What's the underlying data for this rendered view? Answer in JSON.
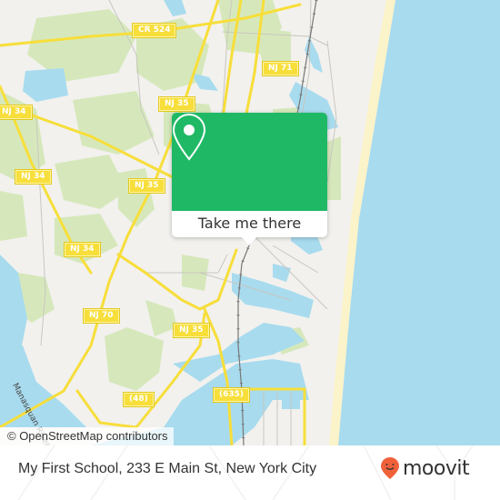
{
  "map": {
    "colors": {
      "land": "#f2f1ee",
      "water": "#a8dbee",
      "park": "#d6e8bb",
      "road_major": "#f7de3a",
      "beach": "#fbf3c9"
    },
    "road_labels": [
      {
        "id": "cr524",
        "text": "CR 524"
      },
      {
        "id": "nj71",
        "text": "NJ 71"
      },
      {
        "id": "nj35-a",
        "text": "NJ 35"
      },
      {
        "id": "nj34-a",
        "text": "NJ 34"
      },
      {
        "id": "nj34-b",
        "text": "NJ 34"
      },
      {
        "id": "nj35-b",
        "text": "NJ 35"
      },
      {
        "id": "nj34-c",
        "text": "NJ 34"
      },
      {
        "id": "nj70",
        "text": "NJ 70"
      },
      {
        "id": "nj35-c",
        "text": "NJ 35"
      },
      {
        "id": "r48",
        "text": "(48)"
      },
      {
        "id": "r635",
        "text": "(635)"
      }
    ],
    "water_label": "Manasquan River",
    "attribution": "© OpenStreetMap contributors"
  },
  "popup": {
    "icon": "location-pin-icon",
    "accent": "#1fb966",
    "action_label": "Take me there"
  },
  "footer": {
    "address": "My First School, 233 E Main St, New York City",
    "brand": "moovit",
    "brand_color": "#f0613a"
  }
}
